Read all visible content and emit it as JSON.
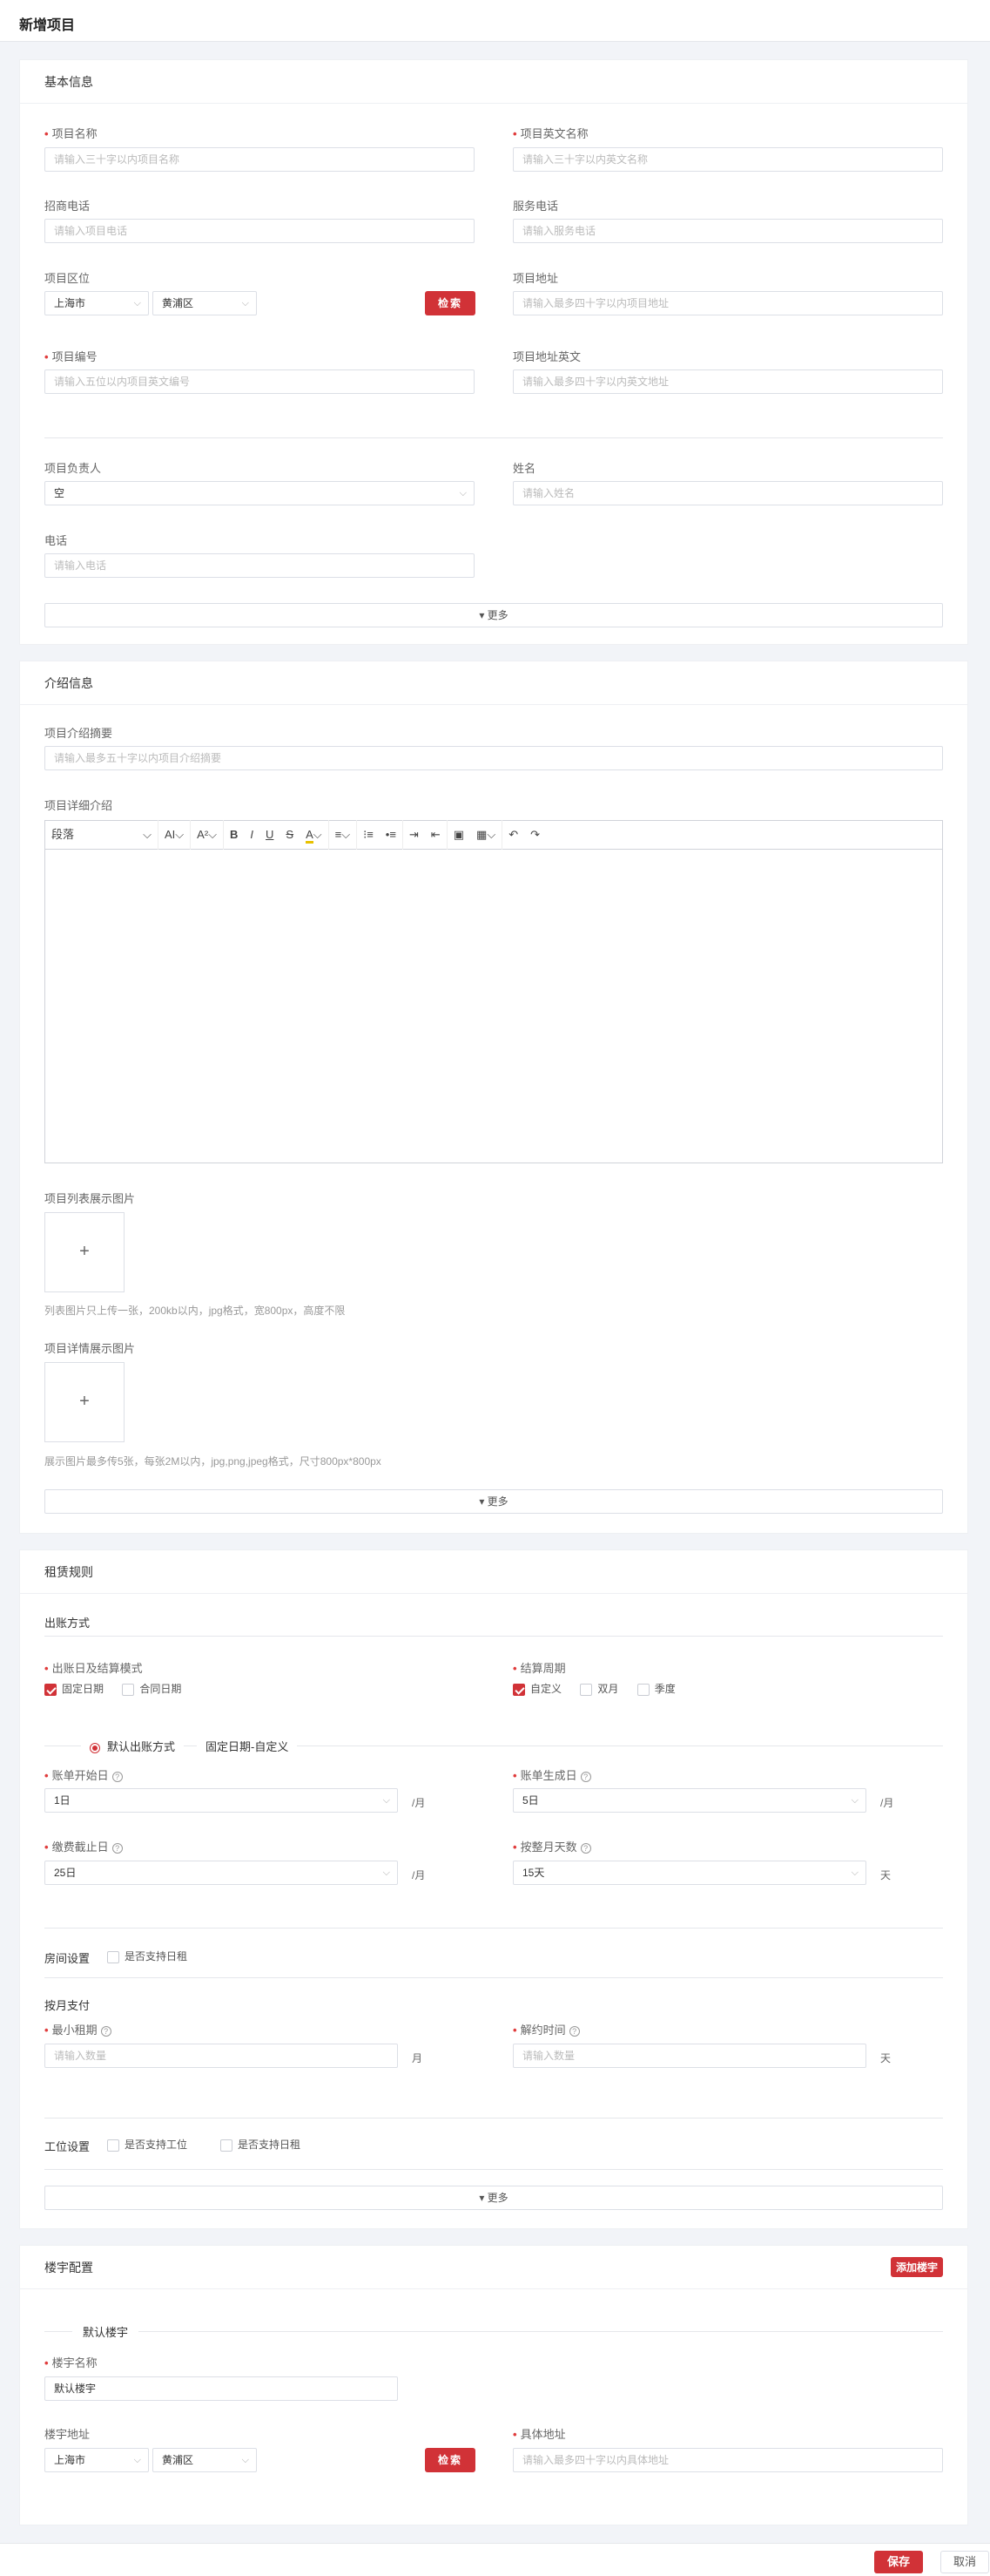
{
  "page_title": "新增项目",
  "basic": {
    "title": "基本信息",
    "project_name": {
      "label": "项目名称",
      "placeholder": "请输入三十字以内项目名称"
    },
    "project_name_en": {
      "label": "项目英文名称",
      "placeholder": "请输入三十字以内英文名称"
    },
    "invest_phone": {
      "label": "招商电话",
      "placeholder": "请输入项目电话"
    },
    "service_phone": {
      "label": "服务电话",
      "placeholder": "请输入服务电话"
    },
    "region": {
      "label": "项目区位",
      "city": "上海市",
      "district": "黄浦区",
      "search": "检索"
    },
    "address": {
      "label": "项目地址",
      "placeholder": "请输入最多四十字以内项目地址"
    },
    "code": {
      "label": "项目编号",
      "placeholder": "请输入五位以内项目英文编号"
    },
    "address_en": {
      "label": "项目地址英文",
      "placeholder": "请输入最多四十字以内英文地址"
    },
    "manager": {
      "label": "项目负责人",
      "value": "空"
    },
    "name": {
      "label": "姓名",
      "placeholder": "请输入姓名"
    },
    "phone": {
      "label": "电话",
      "placeholder": "请输入电话"
    },
    "more": "更多"
  },
  "intro": {
    "title": "介绍信息",
    "summary": {
      "label": "项目介绍摘要",
      "placeholder": "请输入最多五十字以内项目介绍摘要"
    },
    "detail_label": "项目详细介绍",
    "toolbar": {
      "paragraph": "段落",
      "font_size": "AI",
      "font_family": "A²",
      "bold": "B",
      "italic": "I",
      "underline": "U",
      "strike": "S",
      "highlight": "A"
    },
    "list_image": {
      "label": "项目列表展示图片",
      "plus": "+",
      "hint": "列表图片只上传一张，200kb以内，jpg格式，宽800px，高度不限"
    },
    "detail_image": {
      "label": "项目详情展示图片",
      "plus": "+",
      "hint": "展示图片最多传5张，每张2M以内，jpg,png,jpeg格式，尺寸800px*800px"
    },
    "more": "更多"
  },
  "rental": {
    "title": "租赁规则",
    "billing_method": "出账方式",
    "mode": {
      "label": "出账日及结算模式",
      "opt1": "固定日期",
      "opt2": "合同日期"
    },
    "cycle": {
      "label": "结算周期",
      "opt1": "自定义",
      "opt2": "双月",
      "opt3": "季度"
    },
    "default_radio": "默认出账方式",
    "default_value": "固定日期-自定义",
    "start_day": {
      "label": "账单开始日",
      "value": "1日",
      "unit": "/月"
    },
    "gen_day": {
      "label": "账单生成日",
      "value": "5日",
      "unit": "/月"
    },
    "due_day": {
      "label": "缴费截止日",
      "value": "25日",
      "unit": "/月"
    },
    "month_days": {
      "label": "按整月天数",
      "value": "15天",
      "unit": "天"
    },
    "room_setting": "房间设置",
    "room_daily": "是否支持日租",
    "monthly_pay": "按月支付",
    "min_term": {
      "label": "最小租期",
      "placeholder": "请输入数量",
      "unit": "月"
    },
    "notice": {
      "label": "解约时间",
      "placeholder": "请输入数量",
      "unit": "天"
    },
    "workstation_setting": "工位设置",
    "ws_support": "是否支持工位",
    "ws_daily": "是否支持日租",
    "more": "更多"
  },
  "building": {
    "title": "楼宇配置",
    "add": "添加楼宇",
    "default_legend": "默认楼宇",
    "name": {
      "label": "楼宇名称",
      "value": "默认楼宇"
    },
    "address": {
      "label": "楼宇地址",
      "city": "上海市",
      "district": "黄浦区",
      "search": "检索"
    },
    "detail_address": {
      "label": "具体地址",
      "placeholder": "请输入最多四十字以内具体地址"
    }
  },
  "footer": {
    "save": "保存",
    "cancel": "取消"
  }
}
